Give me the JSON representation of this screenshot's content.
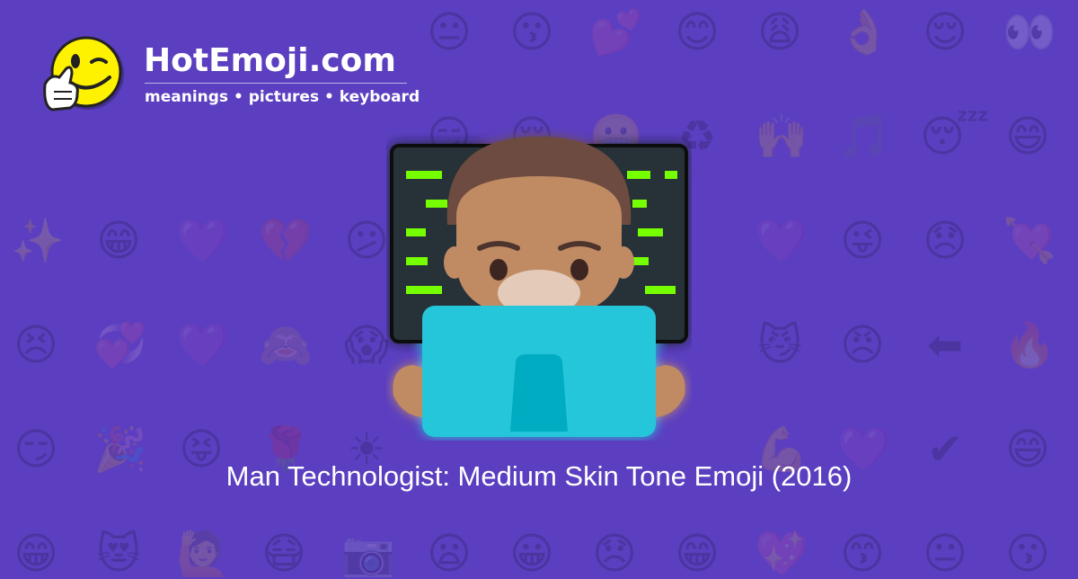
{
  "brand": {
    "prefix": "Hot",
    "bold": "Emoji",
    "suffix": ".com"
  },
  "tagline": "meanings • pictures • keyboard",
  "caption": "Man Technologist: Medium Skin Tone Emoji (2016)",
  "background": {
    "color": "#5b3fc0",
    "pattern": [
      "😐",
      "😗",
      "💕",
      "😊",
      "😩",
      "👌",
      "😌",
      "👀",
      "😏",
      "😌",
      "😬",
      "♻",
      "🙌",
      "🎵",
      "😴",
      "😄",
      "✨",
      "😁",
      "💜",
      "💔",
      "😕",
      "💜",
      "😜",
      "😞",
      "💘",
      "😣",
      "💞",
      "💜",
      "🙈",
      "😱",
      "😼",
      "😠",
      "⬅",
      "🔥",
      "😏",
      "🎉",
      "😝",
      "🌹",
      "☀",
      "💪",
      "💜",
      "✔",
      "😄",
      "😁",
      "😻",
      "🙋",
      "😷",
      "📷",
      "😦",
      "😀",
      "😞",
      "😁",
      "💖",
      "😙"
    ]
  },
  "hero": {
    "emoji": "man-technologist-medium-skin-tone",
    "skin_tone": "#c08b64",
    "hair_color": "#6d4c41",
    "laptop_color": "#26c6da",
    "code_color": "#76ff03"
  }
}
